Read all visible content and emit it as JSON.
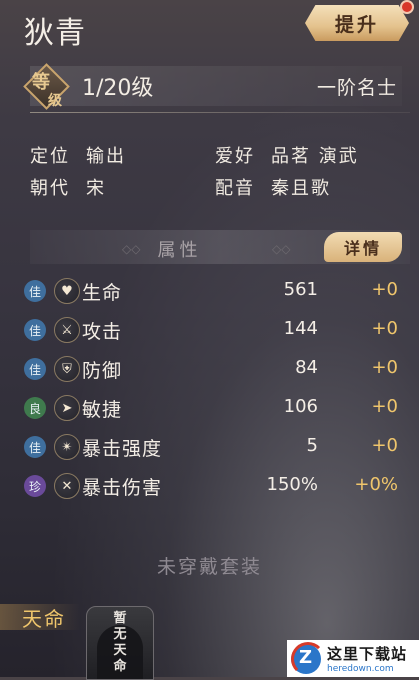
{
  "hero": {
    "name": "狄青",
    "upgrade_label": "提升"
  },
  "level": {
    "badge_top": "等",
    "badge_bottom": "级",
    "text": "1/20级",
    "rank": "一阶名士"
  },
  "info": {
    "role_label": "定位",
    "role_value": "输出",
    "hobby_label": "爱好",
    "hobby_value": "品茗 演武",
    "dynasty_label": "朝代",
    "dynasty_value": "宋",
    "voice_label": "配音",
    "voice_value": "秦且歌"
  },
  "attributes": {
    "title": "属性",
    "detail_label": "详情",
    "rows": [
      {
        "grade": "佳",
        "grade_color": "#3f6f9e",
        "icon": "heart-icon",
        "glyph": "♥",
        "label": "生命",
        "value": "561",
        "bonus": "+0"
      },
      {
        "grade": "佳",
        "grade_color": "#3f6f9e",
        "icon": "sword-icon",
        "glyph": "⚔",
        "label": "攻击",
        "value": "144",
        "bonus": "+0"
      },
      {
        "grade": "佳",
        "grade_color": "#3f6f9e",
        "icon": "shield-icon",
        "glyph": "⛨",
        "label": "防御",
        "value": "84",
        "bonus": "+0"
      },
      {
        "grade": "良",
        "grade_color": "#3f7a4d",
        "icon": "boot-icon",
        "glyph": "➤",
        "label": "敏捷",
        "value": "106",
        "bonus": "+0"
      },
      {
        "grade": "佳",
        "grade_color": "#3f6f9e",
        "icon": "star-icon",
        "glyph": "✴",
        "label": "暴击强度",
        "value": "5",
        "bonus": "+0"
      },
      {
        "grade": "珍",
        "grade_color": "#6a4a9a",
        "icon": "blade-icon",
        "glyph": "✕",
        "label": "暴击伤害",
        "value": "150%",
        "bonus": "+0%"
      }
    ]
  },
  "equipment": {
    "no_set": "未穿戴套装"
  },
  "fate": {
    "label": "天命",
    "card_text": "暂无天命"
  },
  "watermark": {
    "title": "这里下载站",
    "url": "heredown.com"
  }
}
